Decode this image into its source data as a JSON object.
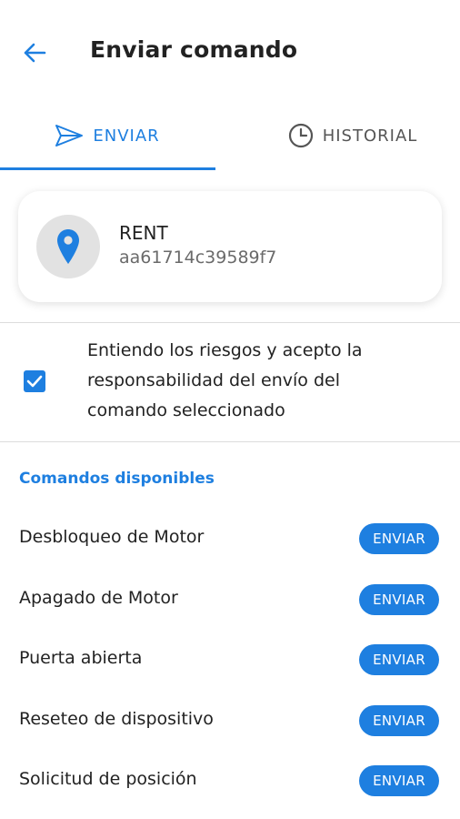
{
  "header": {
    "title": "Enviar comando",
    "back_icon": "arrow-left-icon"
  },
  "tabs": [
    {
      "label": "ENVIAR",
      "icon": "send-icon",
      "active": true
    },
    {
      "label": "HISTORIAL",
      "icon": "clock-icon",
      "active": false
    }
  ],
  "device": {
    "name": "RENT",
    "id": "aa61714c39589f7",
    "icon": "location-pin-icon"
  },
  "consent": {
    "checked": true,
    "line1": "Entiendo los riesgos y acepto la",
    "line2": "responsabilidad del envío del",
    "line3": "comando seleccionado"
  },
  "commands": {
    "section_title": "Comandos disponibles",
    "items": [
      {
        "label": "Desbloqueo de Motor",
        "button": "ENVIAR"
      },
      {
        "label": "Apagado de Motor",
        "button": "ENVIAR"
      },
      {
        "label": "Puerta abierta",
        "button": "ENVIAR"
      },
      {
        "label": "Reseteo de dispositivo",
        "button": "ENVIAR"
      },
      {
        "label": "Solicitud de posición",
        "button": "ENVIAR"
      }
    ]
  },
  "colors": {
    "accent": "#1e7fe0",
    "text": "#222222",
    "muted": "#6a6a6a",
    "avatar_bg": "#e2e2e2"
  }
}
